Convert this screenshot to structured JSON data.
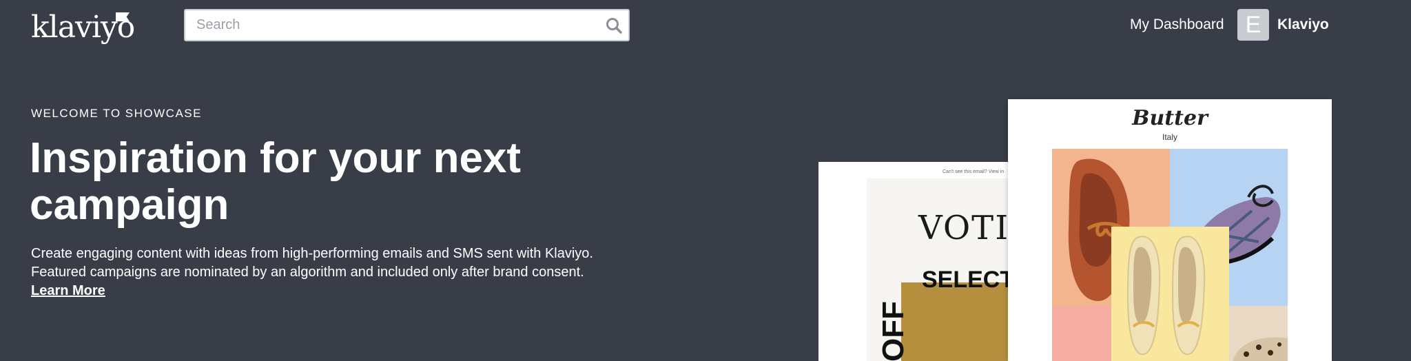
{
  "header": {
    "logo_text": "klaviyo",
    "search_placeholder": "Search",
    "dashboard_link": "My Dashboard",
    "avatar_initial": "E",
    "account_name": "Klaviyo"
  },
  "hero": {
    "eyebrow": "WELCOME TO SHOWCASE",
    "headline": "Inspiration for your next campaign",
    "description_line1": "Create engaging content with ideas from high-performing emails and SMS sent with Klaviyo.",
    "description_line2": "Featured campaigns are nominated by an algorithm and included only after brand consent.",
    "learn_more": "Learn More"
  },
  "previews": {
    "back_card": {
      "tiny_text": "Can't see this email? View in",
      "heading": "VOTI",
      "select_text": "SELECT",
      "off_text": "OFF"
    },
    "front_card": {
      "brand": "Butter",
      "brand_sub": "Italy"
    }
  },
  "colors": {
    "background": "#383d47",
    "text": "#ffffff",
    "avatar": "#c8cbd0"
  }
}
